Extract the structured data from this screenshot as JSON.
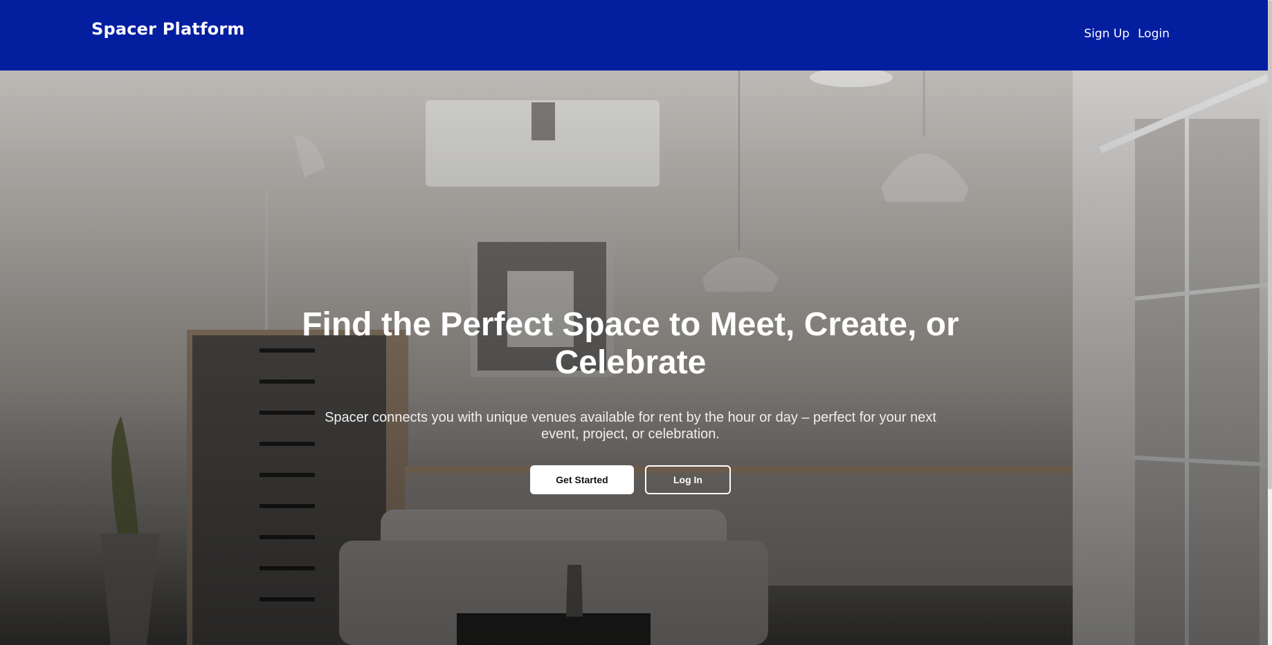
{
  "nav": {
    "brand": "Spacer Platform",
    "links": [
      "Sign Up",
      "Login"
    ]
  },
  "hero": {
    "title": "Find the Perfect Space to Meet, Create, or Celebrate",
    "subtitle": "Spacer connects you with unique venues available for rent by the hour or day – perfect for your next event, project, or celebration.",
    "primary_button": "Get Started",
    "secondary_button": "Log In"
  },
  "colors": {
    "nav_background": "#041ea0",
    "text": "#ffffff"
  }
}
